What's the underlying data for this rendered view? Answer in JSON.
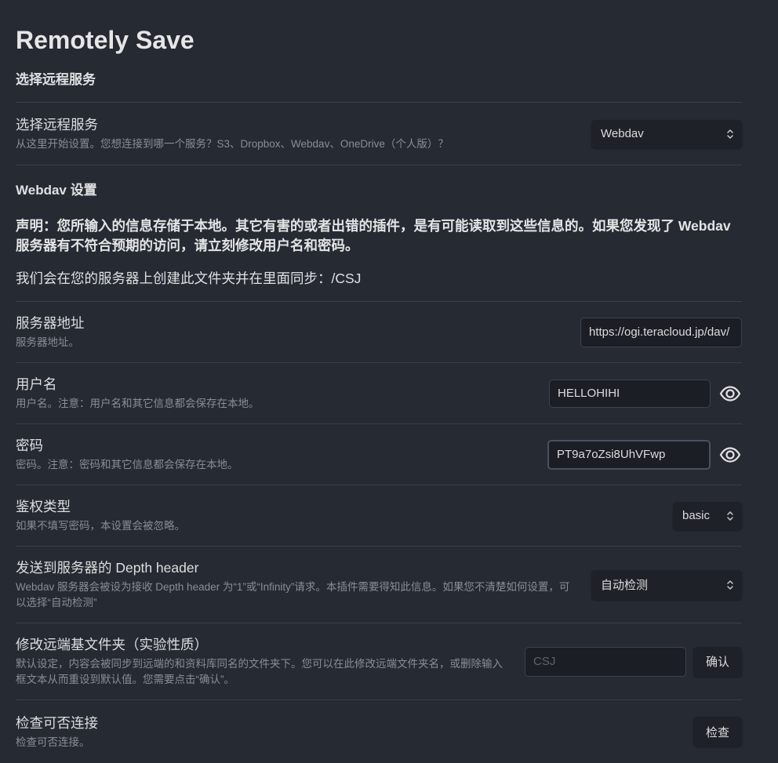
{
  "app_title": "Remotely Save",
  "service_section": {
    "heading": "选择远程服务",
    "row": {
      "name": "选择远程服务",
      "desc": "从这里开始设置。您想连接到哪一个服务？S3、Dropbox、Webdav、OneDrive（个人版）？",
      "selected": "Webdav"
    }
  },
  "webdav_section": {
    "heading": "Webdav 设置",
    "notice": "声明：您所输入的信息存储于本地。其它有害的或者出错的插件，是有可能读取到这些信息的。如果您发现了 Webdav 服务器有不符合预期的访问，请立刻修改用户名和密码。",
    "folder_line": "我们会在您的服务器上创建此文件夹并在里面同步：/CSJ"
  },
  "server_address": {
    "name": "服务器地址",
    "desc": "服务器地址。",
    "value": "https://ogi.teracloud.jp/dav/"
  },
  "username": {
    "name": "用户名",
    "desc": "用户名。注意：用户名和其它信息都会保存在本地。",
    "value": "HELLOHIHI",
    "icon": "eye-icon"
  },
  "password": {
    "name": "密码",
    "desc": "密码。注意：密码和其它信息都会保存在本地。",
    "value": "PT9a7oZsi8UhVFwp",
    "icon": "eye-icon"
  },
  "auth_type": {
    "name": "鉴权类型",
    "desc": "如果不填写密码，本设置会被忽略。",
    "selected": "basic"
  },
  "depth_header": {
    "name": "发送到服务器的 Depth header",
    "desc": "Webdav 服务器会被设为接收 Depth header 为“1”或“Infinity”请求。本插件需要得知此信息。如果您不清楚如何设置，可以选择“自动检测”",
    "selected": "自动检测"
  },
  "remote_base_dir": {
    "name": "修改远端基文件夹（实验性质）",
    "desc": "默认设定，内容会被同步到远端的和资料库同名的文件夹下。您可以在此修改远端文件夹名，或删除输入框文本从而重设到默认值。您需要点击“确认”。",
    "placeholder": "CSJ",
    "confirm_label": "确认"
  },
  "check_connection": {
    "name": "检查可否连接",
    "desc": "检查可否连接。",
    "button_label": "检查"
  }
}
